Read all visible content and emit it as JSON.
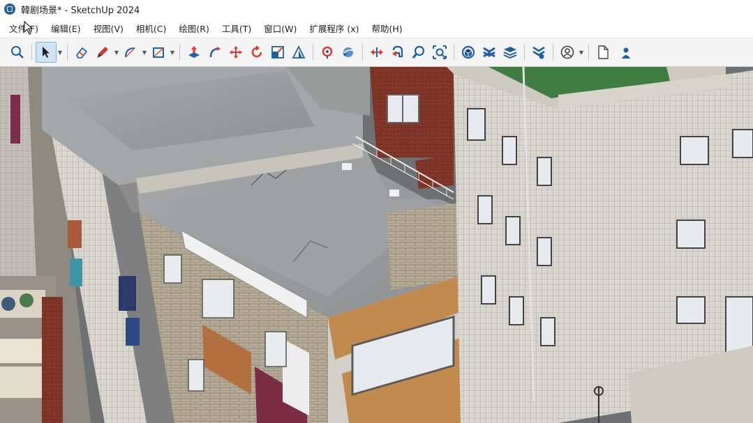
{
  "window": {
    "title": "韓剧场景* - SketchUp 2024"
  },
  "menubar": {
    "items": [
      {
        "label": "文件(F)"
      },
      {
        "label": "编辑(E)"
      },
      {
        "label": "视图(V)"
      },
      {
        "label": "相机(C)"
      },
      {
        "label": "绘图(R)"
      },
      {
        "label": "工具(T)"
      },
      {
        "label": "窗口(W)"
      },
      {
        "label": "扩展程序 (x)"
      },
      {
        "label": "帮助(H)"
      }
    ]
  },
  "toolbar": {
    "tools": [
      {
        "icon": "zoom-extents-icon",
        "selected": false
      },
      {
        "icon": "select-arrow-icon",
        "selected": true
      },
      {
        "icon": "eraser-icon",
        "selected": false
      },
      {
        "icon": "pencil-icon",
        "selected": false
      },
      {
        "icon": "arc-icon",
        "selected": false
      },
      {
        "icon": "rectangle-icon",
        "selected": false
      },
      {
        "icon": "push-pull-icon",
        "selected": false
      },
      {
        "icon": "follow-me-icon",
        "selected": false
      },
      {
        "icon": "move-icon",
        "selected": false
      },
      {
        "icon": "rotate-icon",
        "selected": false
      },
      {
        "icon": "scale-icon",
        "selected": false
      },
      {
        "icon": "offset-icon",
        "selected": false
      },
      {
        "icon": "paint-bucket-icon",
        "selected": false
      },
      {
        "icon": "orbit-icon",
        "selected": false
      },
      {
        "icon": "pan-icon",
        "selected": false
      },
      {
        "icon": "walk-icon",
        "selected": false
      },
      {
        "icon": "zoom-icon",
        "selected": false
      },
      {
        "icon": "zoom-window-icon",
        "selected": false
      },
      {
        "icon": "warehouse-icon",
        "selected": false
      },
      {
        "icon": "extension-warehouse-icon",
        "selected": false
      },
      {
        "icon": "layout-icon",
        "selected": false
      },
      {
        "icon": "trimble-connect-icon",
        "selected": false
      },
      {
        "icon": "account-icon",
        "selected": false
      },
      {
        "icon": "new-file-icon",
        "selected": false
      },
      {
        "icon": "user-icon",
        "selected": false
      }
    ]
  },
  "colors": {
    "accent_blue": "#1d5fa8",
    "accent_red": "#e03a2f",
    "selected_bg": "#cfe3f7"
  }
}
